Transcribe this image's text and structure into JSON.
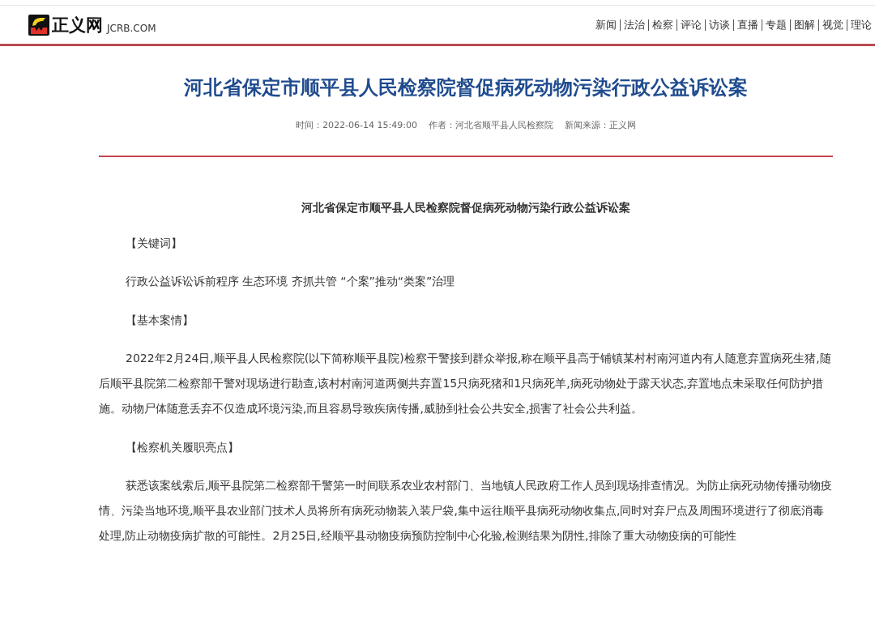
{
  "header": {
    "site_name": "正义网",
    "domain": "JCRB.COM",
    "nav": [
      "新闻",
      "法治",
      "检察",
      "评论",
      "访谈",
      "直播",
      "专题",
      "图解",
      "视觉",
      "理论"
    ]
  },
  "article": {
    "title": "河北省保定市顺平县人民检察院督促病死动物污染行政公益诉讼案",
    "meta": [
      "时间：2022-06-14 15:49:00",
      "作者：河北省顺平县人民检察院",
      "新闻来源：正义网"
    ],
    "blocks": [
      {
        "kind": "heading",
        "text": "河北省保定市顺平县人民检察院督促病死动物污染行政公益诉讼案"
      },
      {
        "kind": "label",
        "text": "【关键词】"
      },
      {
        "kind": "para",
        "text": "行政公益诉讼诉前程序 生态环境 齐抓共管 “个案”推动“类案”治理"
      },
      {
        "kind": "label",
        "text": "【基本案情】"
      },
      {
        "kind": "para",
        "text": "2022年2月24日,顺平县人民检察院(以下简称顺平县院)检察干警接到群众举报,称在顺平县高于铺镇某村村南河道内有人随意弃置病死生猪,随后顺平县院第二检察部干警对现场进行勘查,该村村南河道两侧共弃置15只病死猪和1只病死羊,病死动物处于露天状态,弃置地点未采取任何防护措施。动物尸体随意丢弃不仅造成环境污染,而且容易导致疾病传播,威胁到社会公共安全,损害了社会公共利益。"
      },
      {
        "kind": "label",
        "text": "【检察机关履职亮点】"
      },
      {
        "kind": "para",
        "text": "获悉该案线索后,顺平县院第二检察部干警第一时间联系农业农村部门、当地镇人民政府工作人员到现场排查情况。为防止病死动物传播动物疫情、污染当地环境,顺平县农业部门技术人员将所有病死动物装入装尸袋,集中运往顺平县病死动物收集点,同时对弃尸点及周围环境进行了彻底消毒处理,防止动物疫病扩散的可能性。2月25日,经顺平县动物疫病预防控制中心化验,检测结果为阴性,排除了重大动物疫病的可能性"
      }
    ]
  }
}
